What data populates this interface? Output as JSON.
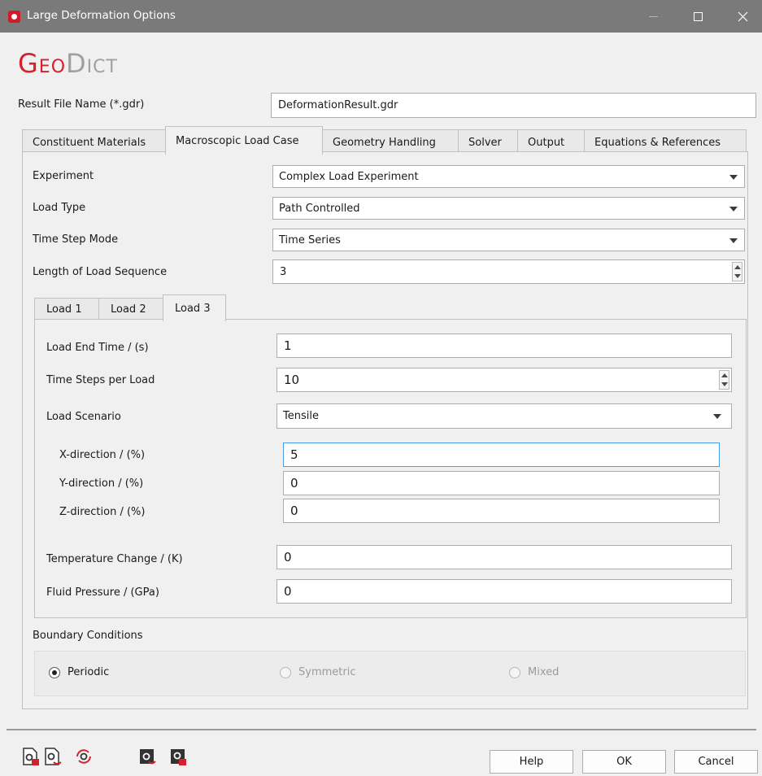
{
  "window": {
    "title": "Large Deformation Options",
    "accent": "#d3212d"
  },
  "logo": {
    "part1": "Geo",
    "part2": "Dict"
  },
  "result_file": {
    "label": "Result File Name (*.gdr)",
    "value": "DeformationResult.gdr"
  },
  "tabs": [
    {
      "label": "Constituent Materials"
    },
    {
      "label": "Macroscopic Load Case"
    },
    {
      "label": "Geometry Handling"
    },
    {
      "label": "Solver"
    },
    {
      "label": "Output"
    },
    {
      "label": "Equations & References"
    }
  ],
  "active_tab": "Macroscopic Load Case",
  "macro": {
    "experiment": {
      "label": "Experiment",
      "value": "Complex Load Experiment"
    },
    "load_type": {
      "label": "Load Type",
      "value": "Path Controlled"
    },
    "time_step_mode": {
      "label": "Time Step Mode",
      "value": "Time Series"
    },
    "length_seq": {
      "label": "Length of Load Sequence",
      "value": "3"
    }
  },
  "load_tabs": [
    {
      "label": "Load 1"
    },
    {
      "label": "Load 2"
    },
    {
      "label": "Load 3"
    }
  ],
  "active_load_tab": "Load 3",
  "load": {
    "end_time": {
      "label": "Load End Time / (s)",
      "value": "1"
    },
    "time_steps": {
      "label": "Time Steps per Load",
      "value": "10"
    },
    "scenario": {
      "label": "Load Scenario",
      "value": "Tensile"
    },
    "x_dir": {
      "label": "X-direction / (%)",
      "value": "5"
    },
    "y_dir": {
      "label": "Y-direction / (%)",
      "value": "0"
    },
    "z_dir": {
      "label": "Z-direction / (%)",
      "value": "0"
    },
    "temp_change": {
      "label": "Temperature Change / (K)",
      "value": "0"
    },
    "fluid_pressure": {
      "label": "Fluid Pressure / (GPa)",
      "value": "0"
    }
  },
  "boundary": {
    "label": "Boundary Conditions",
    "options": [
      {
        "label": "Periodic",
        "selected": true,
        "enabled": true
      },
      {
        "label": "Symmetric",
        "selected": false,
        "enabled": false
      },
      {
        "label": "Mixed",
        "selected": false,
        "enabled": false
      }
    ]
  },
  "toolbar_icons": [
    "load-settings-icon",
    "save-settings-icon",
    "reset-settings-icon",
    "import-settings-icon",
    "export-settings-icon"
  ],
  "buttons": {
    "help": "Help",
    "ok": "OK",
    "cancel": "Cancel"
  }
}
